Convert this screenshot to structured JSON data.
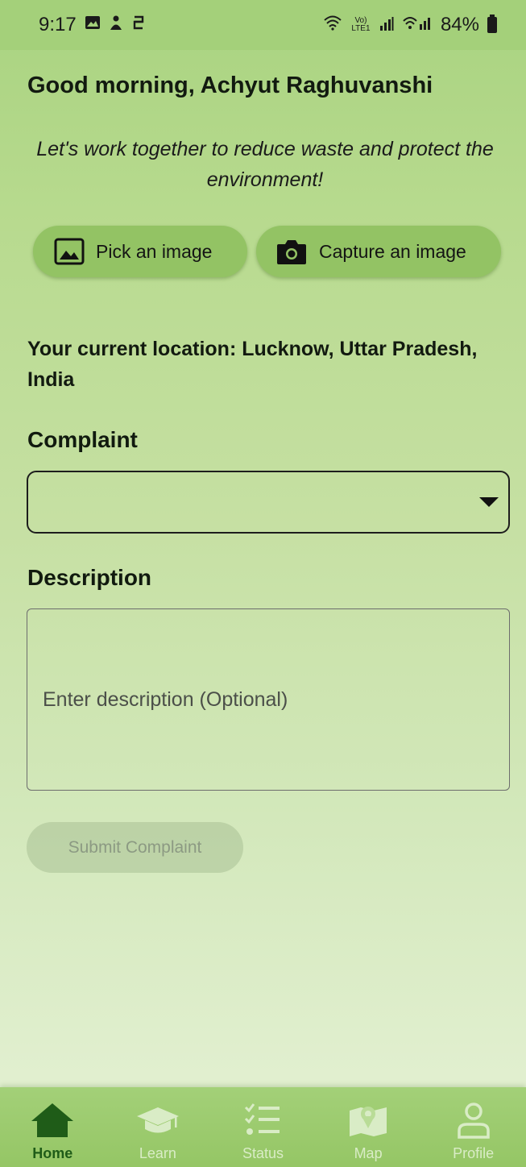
{
  "status_bar": {
    "time": "9:17",
    "battery": "84%",
    "left_icons": [
      "gallery-notification-icon",
      "app-notification-icon",
      "sync-notification-icon"
    ],
    "right_icons": [
      "wifi-icon",
      "volte-icon",
      "signal-icon",
      "signal-2-icon",
      "battery-icon"
    ],
    "network_text": "Vo) LTE1"
  },
  "greeting": "Good morning, Achyut Raghuvanshi",
  "tagline": "Let's work together to reduce waste and protect the environment!",
  "actions": {
    "pick_label": "Pick an image",
    "capture_label": "Capture an image"
  },
  "location_text": "Your current location: Lucknow, Uttar Pradesh, India",
  "complaint": {
    "label": "Complaint",
    "selected_value": ""
  },
  "description": {
    "label": "Description",
    "placeholder": "Enter description (Optional)"
  },
  "submit_label": "Submit Complaint",
  "nav": {
    "items": [
      {
        "label": "Home",
        "icon": "home-icon",
        "active": true
      },
      {
        "label": "Learn",
        "icon": "graduation-cap-icon",
        "active": false
      },
      {
        "label": "Status",
        "icon": "checklist-icon",
        "active": false
      },
      {
        "label": "Map",
        "icon": "map-icon",
        "active": false
      },
      {
        "label": "Profile",
        "icon": "profile-icon",
        "active": false
      }
    ]
  },
  "colors": {
    "background_top": "#a9d380",
    "background_bottom": "#e3f0d3",
    "button": "#93c364",
    "nav_active": "#1f5c18",
    "nav_inactive": "#d9ecc6"
  }
}
